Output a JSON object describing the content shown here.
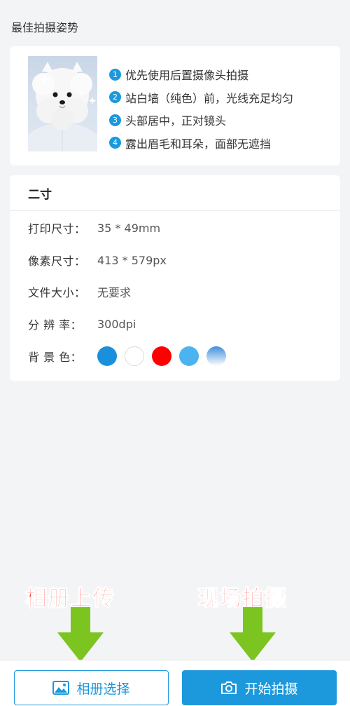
{
  "section_title": "最佳拍摄姿势",
  "tips": [
    {
      "num": "1",
      "text": "优先使用后置摄像头拍摄"
    },
    {
      "num": "2",
      "text": "站白墙（纯色）前，光线充足均匀"
    },
    {
      "num": "3",
      "text": "头部居中，正对镜头"
    },
    {
      "num": "4",
      "text": "露出眉毛和耳朵，面部无遮挡"
    }
  ],
  "spec": {
    "title": "二寸",
    "print_size_label": "打印尺寸：",
    "print_size_value": "35 * 49mm",
    "pixel_size_label": "像素尺寸：",
    "pixel_size_value": "413 * 579px",
    "file_size_label": "文件大小：",
    "file_size_value": "无要求",
    "resolution_label": "分 辨 率：",
    "resolution_value": "300dpi",
    "bg_color_label": "背 景 色：",
    "bg_colors": [
      "#1a8fdb",
      "#ffffff",
      "#ff0000",
      "#4ab3f0",
      "gradient:#3f8fdc-#ffffff"
    ]
  },
  "annotations": {
    "left": "相册上传",
    "right": "现场拍摄"
  },
  "buttons": {
    "album_label": "相册选择",
    "album_icon": "image-icon",
    "shoot_label": "开始拍摄",
    "shoot_icon": "camera-icon"
  },
  "colors": {
    "accent": "#1c98dc",
    "annotation": "#ff2a1f",
    "arrow": "#7cc520"
  }
}
